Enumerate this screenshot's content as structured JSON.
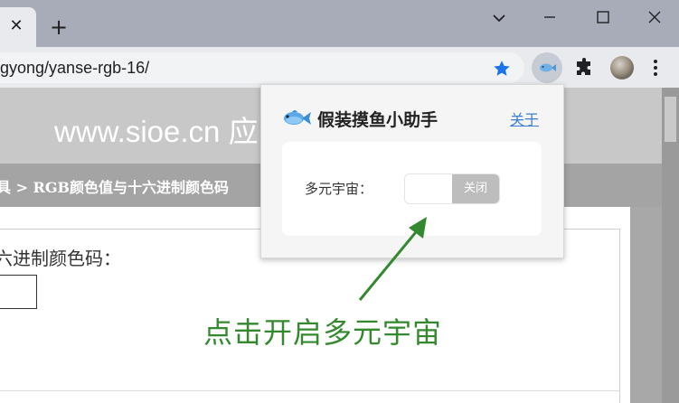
{
  "browser": {
    "tab_close_glyph": "✕",
    "new_tab_glyph": "+",
    "url": "gyong/yanse-rgb-16/",
    "menu_glyph": "⋮",
    "icons": [
      "close-icon",
      "plus-icon",
      "chevron-down-icon",
      "minimize-icon",
      "maximize-icon",
      "window-close-icon",
      "star-icon",
      "fish-extension-icon",
      "puzzle-icon",
      "avatar",
      "kebab-menu-icon"
    ]
  },
  "page": {
    "site_name": "www.sioe.cn 应",
    "breadcrumb": "具  >  RGB颜色值与十六进制颜色码",
    "field_label": "六进制颜色码：",
    "field_value": ""
  },
  "popup": {
    "title": "假装摸鱼小助手",
    "about_link": "关于",
    "metaverse_label": "多元宇宙：",
    "toggle_input_value": "",
    "toggle_state_label": "关闭"
  },
  "annotation": {
    "text": "点击开启多元宇宙",
    "color": "#34892f"
  },
  "colors": {
    "accent_blue": "#1a73e8",
    "link_blue": "#3a7fd5",
    "toggle_off_gray": "#bdbdbd"
  }
}
